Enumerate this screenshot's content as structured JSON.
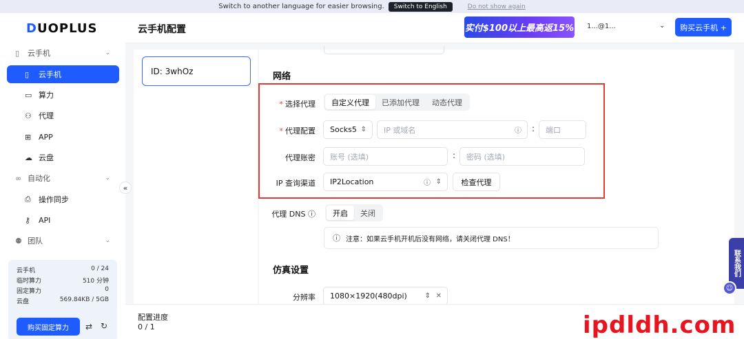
{
  "banner": {
    "message": "Switch to another language for easier browsing.",
    "switch_label": "Switch to English",
    "dismiss_label": "Do not show again"
  },
  "sidebar": {
    "logo": "DUOPLUS",
    "groups": [
      {
        "label": "云手机",
        "items": [
          "云手机",
          "算力",
          "代理",
          "APP",
          "云盘"
        ]
      },
      {
        "label": "自动化",
        "items": [
          "操作同步",
          "API"
        ]
      },
      {
        "label": "团队",
        "items": []
      }
    ],
    "active_item": "云手机",
    "stats": [
      {
        "label": "云手机",
        "value": "0 / 24"
      },
      {
        "label": "临时算力",
        "value": "510 分钟"
      },
      {
        "label": "固定算力",
        "value": "0"
      },
      {
        "label": "云盘",
        "value": "569.84KB / 5GB"
      }
    ],
    "buy_fixed_label": "购买固定算力"
  },
  "header": {
    "title": "云手机配置",
    "promo": "实付$100以上最高返15%",
    "account": "1...@1...",
    "buy_label": "购买云手机 +"
  },
  "device": {
    "label": "ID: 3whOz"
  },
  "network": {
    "title": "网络",
    "proxy_select_label": "选择代理",
    "proxy_options": [
      "自定义代理",
      "已添加代理",
      "动态代理"
    ],
    "proxy_selected": "自定义代理",
    "proxy_config_label": "代理配置",
    "protocol": "Socks5",
    "host_placeholder": "IP 或域名",
    "port_placeholder": "端口",
    "account_label": "代理账密",
    "username_placeholder": "账号 (选填)",
    "password_placeholder": "密码 (选填)",
    "ip_query_label": "IP 查询渠道",
    "ip_query_value": "IP2Location",
    "check_label": "检查代理",
    "dns_label": "代理 DNS",
    "dns_options": [
      "开启",
      "关闭"
    ],
    "dns_selected": "开启",
    "notice": "注意：如果云手机开机后没有网络，请关闭代理 DNS！"
  },
  "simulation": {
    "title": "仿真设置",
    "resolution_label": "分辨率",
    "resolution_value": "1080×1920(480dpi)"
  },
  "progress": {
    "label": "配置进度",
    "value": "0 / 1"
  },
  "contact": "联系我们",
  "watermark": "ipdldh.com"
}
